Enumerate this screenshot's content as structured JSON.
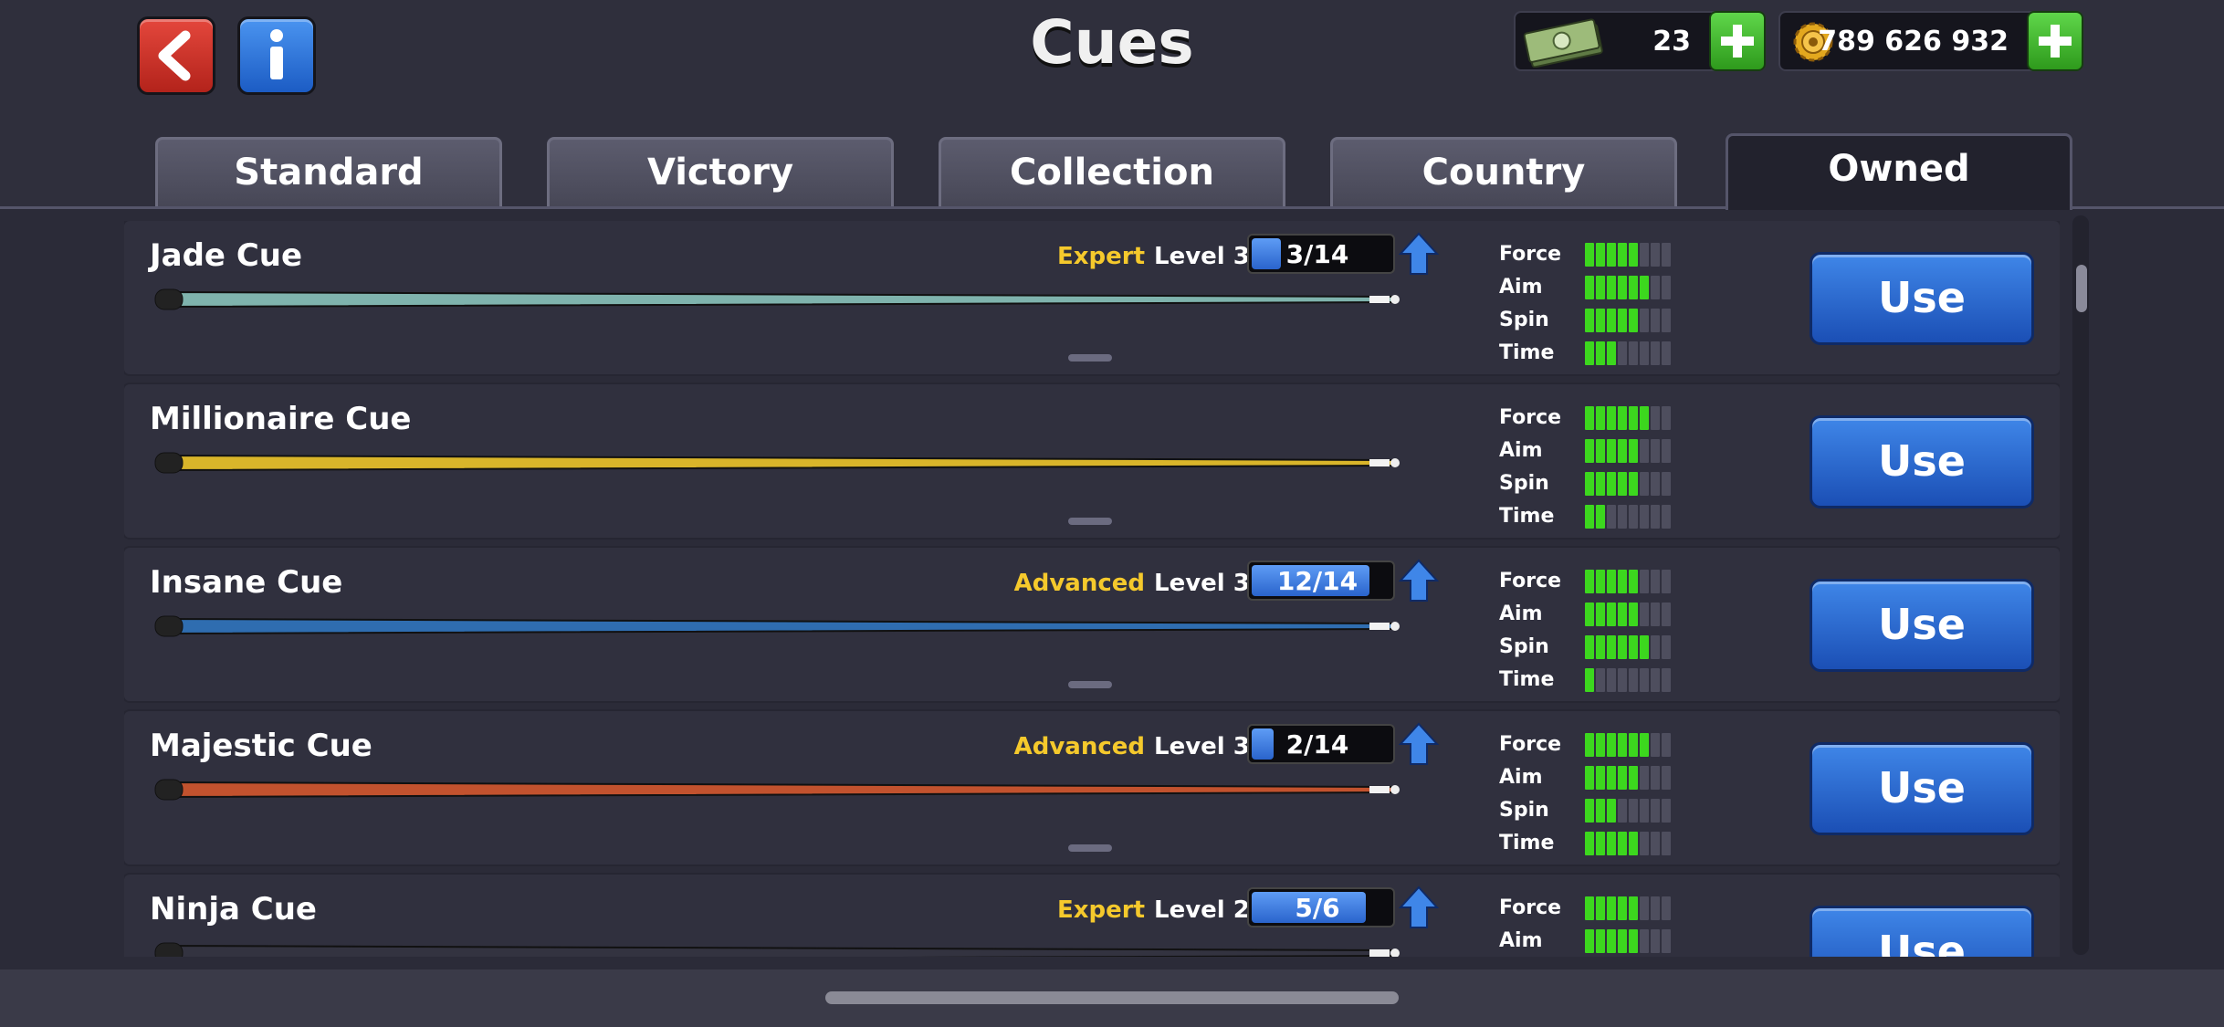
{
  "header": {
    "title": "Cues",
    "cash_value": "23",
    "coins_value": "789 626 932",
    "back_icon": "back-arrow-icon",
    "info_icon": "info-icon"
  },
  "tabs": [
    {
      "label": "Standard",
      "active": false
    },
    {
      "label": "Victory",
      "active": false
    },
    {
      "label": "Collection",
      "active": false
    },
    {
      "label": "Country",
      "active": false
    },
    {
      "label": "Owned",
      "active": true
    }
  ],
  "cues": [
    {
      "name": "Jade Cue",
      "grade": "Expert",
      "level": "Level 3",
      "progress": "3/14",
      "progress_fraction": 0.21,
      "stats": [
        {
          "label": "Force",
          "value": 5
        },
        {
          "label": "Aim",
          "value": 6
        },
        {
          "label": "Spin",
          "value": 5
        },
        {
          "label": "Time",
          "value": 3
        }
      ],
      "use_label": "Use",
      "color": "#7fb3ad"
    },
    {
      "name": "Millionaire Cue",
      "grade": "",
      "level": "",
      "progress": "",
      "progress_fraction": 0,
      "stats": [
        {
          "label": "Force",
          "value": 6
        },
        {
          "label": "Aim",
          "value": 5
        },
        {
          "label": "Spin",
          "value": 5
        },
        {
          "label": "Time",
          "value": 2
        }
      ],
      "use_label": "Use",
      "color": "#d9b52a"
    },
    {
      "name": "Insane Cue",
      "grade": "Advanced",
      "level": "Level 3",
      "progress": "12/14",
      "progress_fraction": 0.86,
      "stats": [
        {
          "label": "Force",
          "value": 5
        },
        {
          "label": "Aim",
          "value": 5
        },
        {
          "label": "Spin",
          "value": 6
        },
        {
          "label": "Time",
          "value": 1
        }
      ],
      "use_label": "Use",
      "color": "#2f6db0"
    },
    {
      "name": "Majestic Cue",
      "grade": "Advanced",
      "level": "Level 3",
      "progress": "2/14",
      "progress_fraction": 0.14,
      "stats": [
        {
          "label": "Force",
          "value": 6
        },
        {
          "label": "Aim",
          "value": 5
        },
        {
          "label": "Spin",
          "value": 3
        },
        {
          "label": "Time",
          "value": 5
        }
      ],
      "use_label": "Use",
      "color": "#c2522e"
    },
    {
      "name": "Ninja Cue",
      "grade": "Expert",
      "level": "Level 2",
      "progress": "5/6",
      "progress_fraction": 0.83,
      "stats": [
        {
          "label": "Force",
          "value": 5
        },
        {
          "label": "Aim",
          "value": 5
        }
      ],
      "use_label": "Use",
      "color": "#333340"
    }
  ],
  "colors": {
    "expert": "#f5c92c",
    "advanced": "#f5c92c",
    "stat_on": "#3cd71e",
    "stat_off": "#4e4e5e",
    "use_button": "#2a64cc"
  }
}
